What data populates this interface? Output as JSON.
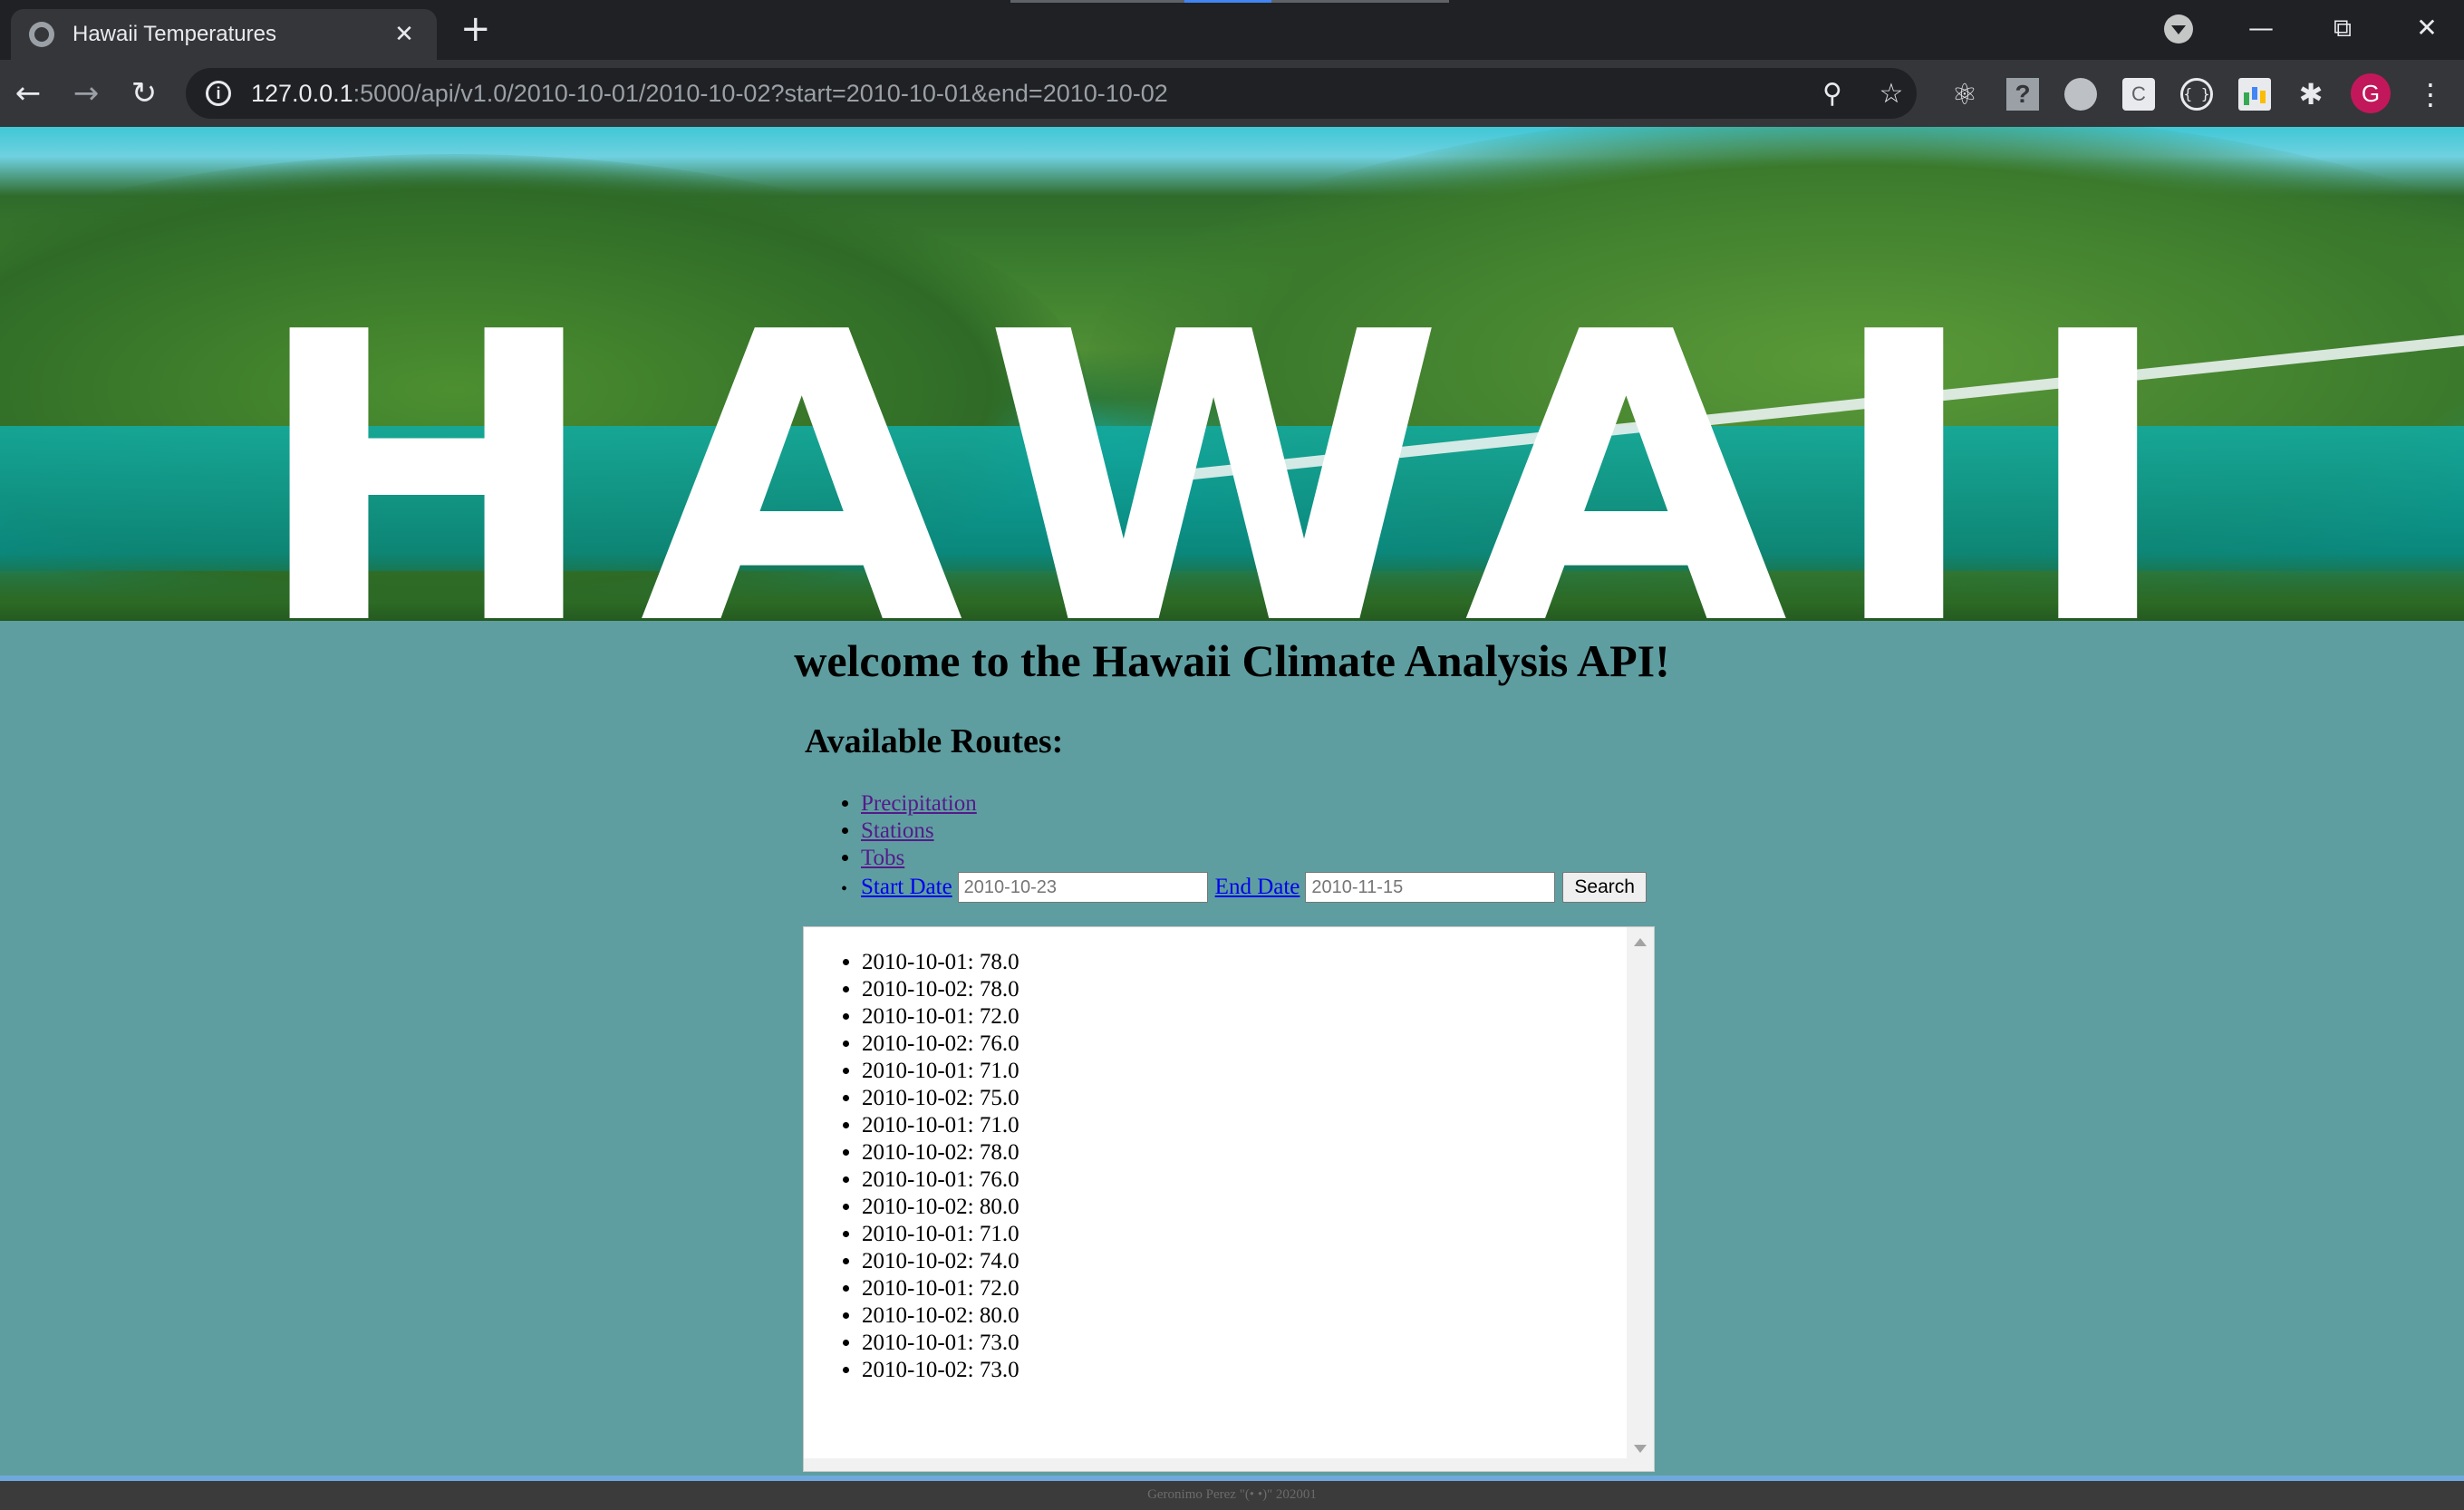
{
  "browser": {
    "tab_title": "Hawaii Temperatures",
    "tab_close": "✕",
    "new_tab": "+",
    "url_host": "127.0.0.1",
    "url_rest": ":5000/api/v1.0/2010-10-01/2010-10-02?start=2010-10-01&end=2010-10-02",
    "avatar_letter": "G",
    "icons": [
      "globe-icon",
      "close-icon",
      "plus-icon",
      "back-arrow-icon",
      "forward-arrow-icon",
      "reload-icon",
      "info-icon",
      "zoom-icon",
      "star-icon",
      "react-devtools-icon",
      "help-extension-icon",
      "chat-extension-icon",
      "c-extension-icon",
      "json-extension-icon",
      "chart-extension-icon",
      "puzzle-icon",
      "more-menu-icon",
      "minimize-icon",
      "restore-icon",
      "window-close-icon"
    ]
  },
  "hero": {
    "word": "HAWAII"
  },
  "page": {
    "title": "welcome to the Hawaii Climate Analysis API!",
    "routes_heading": "Available Routes:",
    "routes": [
      {
        "label": "Precipitation"
      },
      {
        "label": "Stations"
      },
      {
        "label": "Tobs"
      }
    ],
    "start_link": "Start Date",
    "start_value": "2010-10-23",
    "end_link": "End Date",
    "end_value": "2010-11-15",
    "search_label": "Search"
  },
  "results": [
    "2010-10-01: 78.0",
    "2010-10-02: 78.0",
    "2010-10-01: 72.0",
    "2010-10-02: 76.0",
    "2010-10-01: 71.0",
    "2010-10-02: 75.0",
    "2010-10-01: 71.0",
    "2010-10-02: 78.0",
    "2010-10-01: 76.0",
    "2010-10-02: 80.0",
    "2010-10-01: 71.0",
    "2010-10-02: 74.0",
    "2010-10-01: 72.0",
    "2010-10-02: 80.0",
    "2010-10-01: 73.0",
    "2010-10-02: 73.0"
  ],
  "footer": {
    "text": "Geronimo Perez \"(• •)\" 202001"
  }
}
